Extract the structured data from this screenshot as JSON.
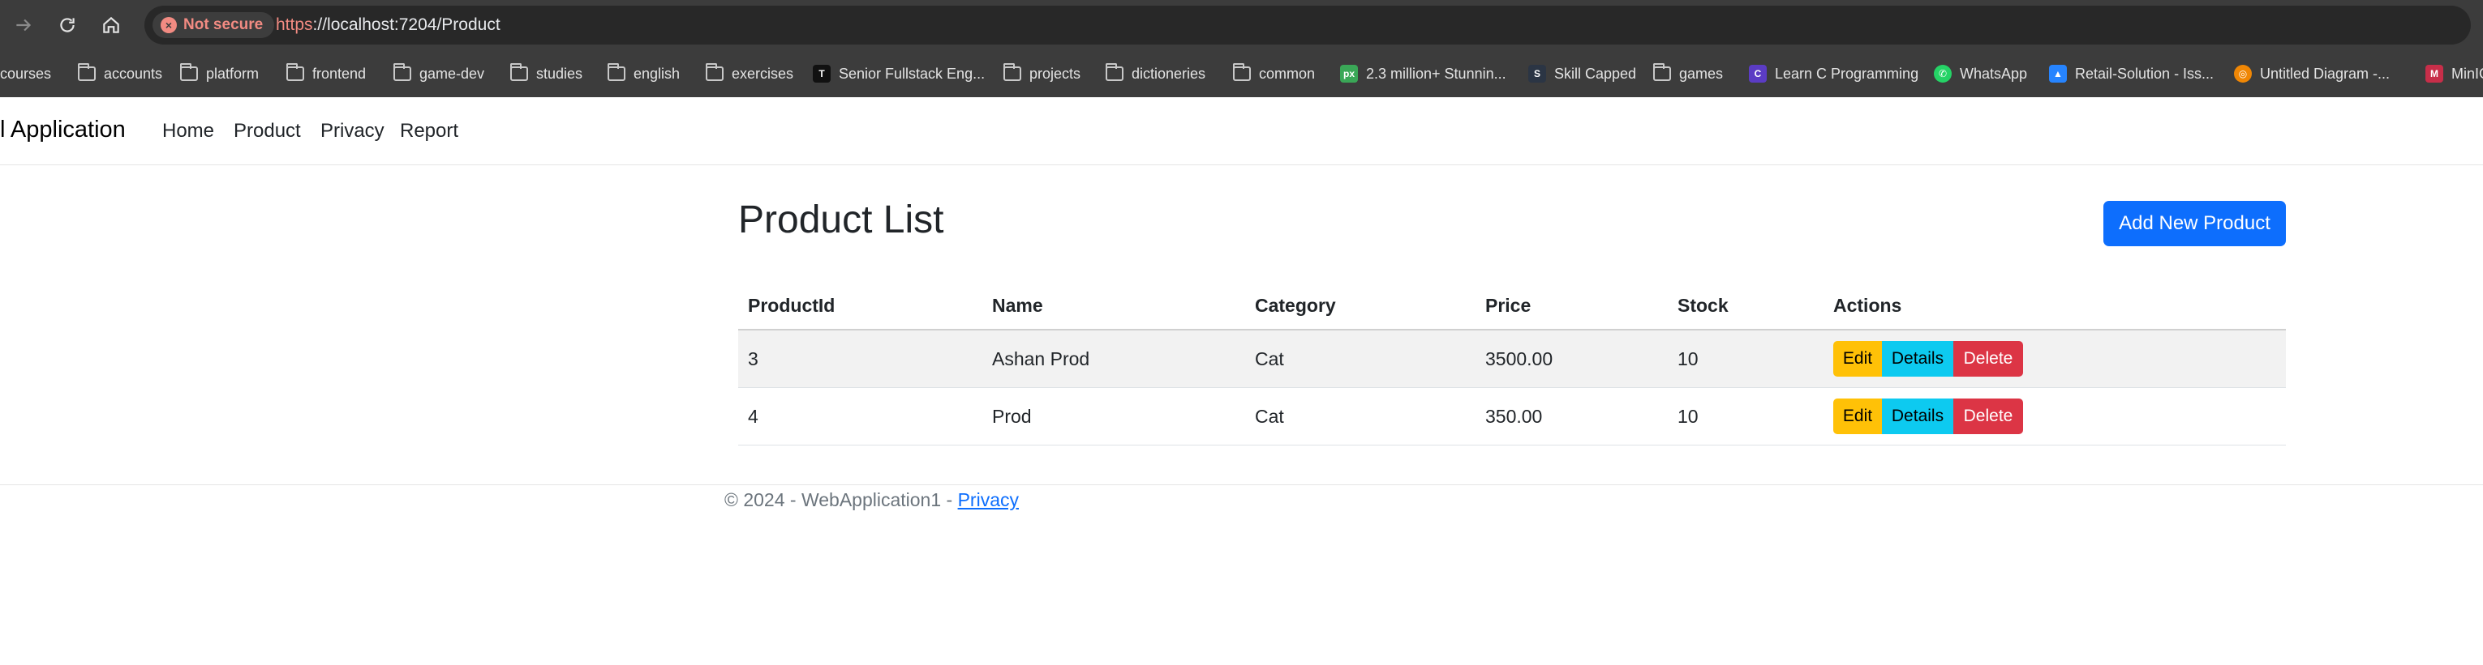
{
  "browser": {
    "security_label": "Not secure",
    "url_scheme": "https",
    "url_rest": "://localhost:7204/Product",
    "bookmarks": [
      {
        "label": "courses",
        "icon": "folder-icon"
      },
      {
        "label": "accounts",
        "icon": "folder-icon"
      },
      {
        "label": "platform",
        "icon": "folder-icon"
      },
      {
        "label": "frontend",
        "icon": "folder-icon"
      },
      {
        "label": "game-dev",
        "icon": "folder-icon"
      },
      {
        "label": "studies",
        "icon": "folder-icon"
      },
      {
        "label": "english",
        "icon": "folder-icon"
      },
      {
        "label": "exercises",
        "icon": "folder-icon"
      },
      {
        "label": "Senior Fullstack Eng...",
        "icon": "site-favicon"
      },
      {
        "label": "projects",
        "icon": "folder-icon"
      },
      {
        "label": "dictioneries",
        "icon": "folder-icon"
      },
      {
        "label": "common",
        "icon": "folder-icon"
      },
      {
        "label": "2.3 million+ Stunnin...",
        "icon": "site-favicon"
      },
      {
        "label": "Skill Capped",
        "icon": "site-favicon"
      },
      {
        "label": "games",
        "icon": "folder-icon"
      },
      {
        "label": "Learn C Programming",
        "icon": "site-favicon"
      },
      {
        "label": "WhatsApp",
        "icon": "whatsapp-icon"
      },
      {
        "label": "Retail-Solution - Iss...",
        "icon": "site-favicon"
      },
      {
        "label": "Untitled Diagram -...",
        "icon": "site-favicon"
      },
      {
        "label": "MinIO",
        "icon": "site-favicon"
      }
    ]
  },
  "navbar": {
    "brand": "l Application",
    "links": [
      "Home",
      "Product",
      "Privacy",
      "Report"
    ]
  },
  "main": {
    "title": "Product List",
    "add_button": "Add New Product",
    "table": {
      "headers": [
        "ProductId",
        "Name",
        "Category",
        "Price",
        "Stock",
        "Actions"
      ],
      "rows": [
        {
          "id": "3",
          "name": "Ashan Prod",
          "category": "Cat",
          "price": "3500.00",
          "stock": "10"
        },
        {
          "id": "4",
          "name": "Prod",
          "category": "Cat",
          "price": "350.00",
          "stock": "10"
        }
      ],
      "actions": {
        "edit": "Edit",
        "details": "Details",
        "delete": "Delete"
      }
    }
  },
  "footer": {
    "text": "© 2024 - WebApplication1 - ",
    "link": "Privacy"
  },
  "colors": {
    "primary": "#0d6efd",
    "warning": "#ffc107",
    "info": "#0dcaf0",
    "danger": "#dc3545",
    "chrome": "#3c3c3c"
  }
}
